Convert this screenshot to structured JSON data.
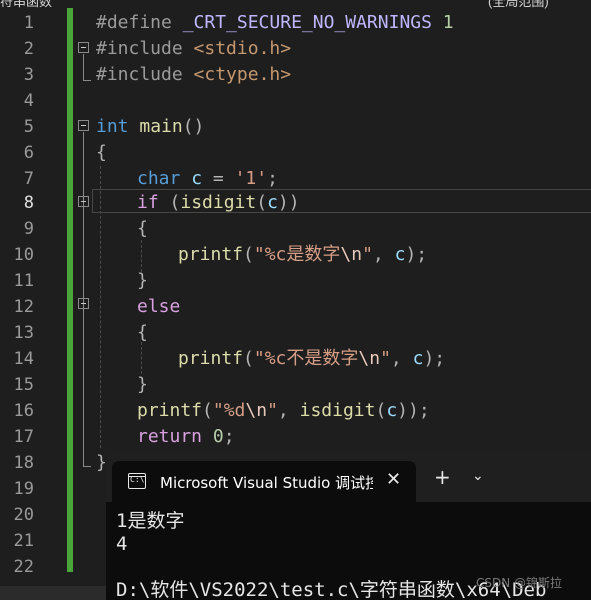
{
  "top_strip": {
    "left_fragment": "符串函数",
    "right_fragment": "(全局范围)"
  },
  "editor": {
    "current_line": 8,
    "line_numbers": [
      "1",
      "2",
      "3",
      "4",
      "5",
      "6",
      "7",
      "8",
      "9",
      "10",
      "11",
      "12",
      "13",
      "14",
      "15",
      "16",
      "17",
      "18",
      "19",
      "20",
      "21",
      "22"
    ],
    "code": {
      "l1_directive": "#define",
      "l1_macro": "_CRT_SECURE_NO_WARNINGS",
      "l1_value": "1",
      "l2_directive": "#include",
      "l2_header": "<stdio.h>",
      "l3_directive": "#include",
      "l3_header": "<ctype.h>",
      "l5_type": "int",
      "l5_name": "main",
      "l5_parens": "()",
      "l6_brace": "{",
      "l7_type": "char",
      "l7_var": "c",
      "l7_eq": "=",
      "l7_value": "'1'",
      "l7_semi": ";",
      "l8_kw": "if",
      "l8_open": "(",
      "l8_fn": "isdigit",
      "l8_arg_open": "(",
      "l8_var": "c",
      "l8_close": "))",
      "l9_brace": "{",
      "l10_fn": "printf",
      "l10_open": "(",
      "l10_str1": "\"%c是数字",
      "l10_esc": "\\n",
      "l10_str2": "\"",
      "l10_comma": ",",
      "l10_var": "c",
      "l10_close": ");",
      "l11_brace": "}",
      "l12_kw": "else",
      "l13_brace": "{",
      "l14_fn": "printf",
      "l14_open": "(",
      "l14_str1": "\"%c不是数字",
      "l14_esc": "\\n",
      "l14_str2": "\"",
      "l14_comma": ",",
      "l14_var": "c",
      "l14_close": ");",
      "l15_brace": "}",
      "l16_fn": "printf",
      "l16_open": "(",
      "l16_str1": "\"%d",
      "l16_esc": "\\n",
      "l16_str2": "\"",
      "l16_comma": ",",
      "l16_fn2": "isdigit",
      "l16_open2": "(",
      "l16_var": "c",
      "l16_close": "));",
      "l17_kw": "return",
      "l17_num": "0",
      "l17_semi": ";",
      "l18_brace": "}"
    }
  },
  "console": {
    "tab_title": "Microsoft Visual Studio 调试控制台",
    "tab_icon": "C:\\",
    "close_glyph": "✕",
    "add_glyph": "+",
    "dropdown_glyph": "⌄",
    "output_lines": [
      "1是数字",
      "4",
      "",
      "D:\\软件\\VS2022\\test.c\\字符串函数\\x64\\Deb"
    ]
  },
  "watermark": "CSDN @锦斯拉",
  "colors": {
    "editor_bg": "#1e1e1e",
    "change_bar": "#4aa53a",
    "keyword": "#569cd6",
    "control_keyword": "#d8a0df",
    "string": "#d69d85",
    "function": "#dcdcaa",
    "variable": "#9cdcfe",
    "console_bg": "#0c0c0c"
  }
}
